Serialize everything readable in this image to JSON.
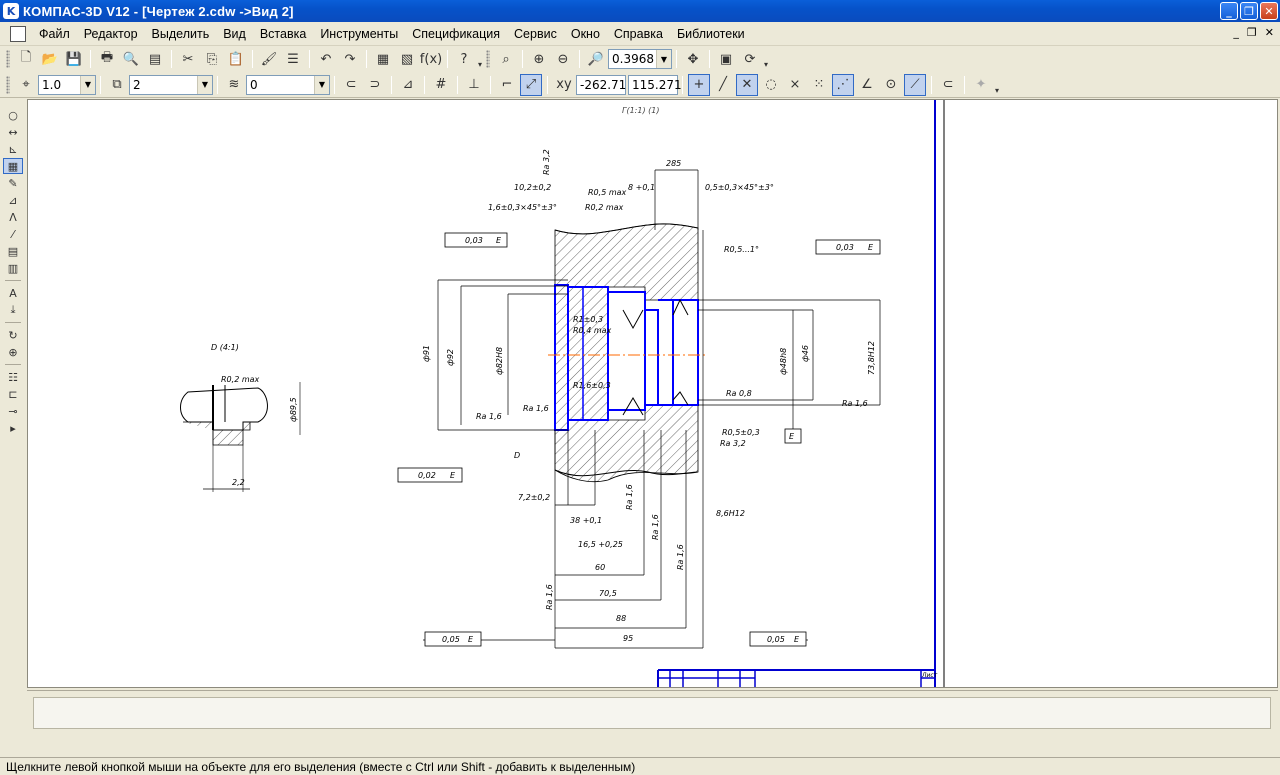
{
  "window": {
    "title": "КОМПАС-3D V12 - [Чертеж 2.cdw ->Вид 2]",
    "minimize": "_",
    "restore": "❐",
    "close": "✕"
  },
  "menu": [
    "Файл",
    "Редактор",
    "Выделить",
    "Вид",
    "Вставка",
    "Инструменты",
    "Спецификация",
    "Сервис",
    "Окно",
    "Справка",
    "Библиотеки"
  ],
  "toolbar_main": {
    "zoom_value": "0.3968"
  },
  "toolbar_params": {
    "step_value": "1.0",
    "layer_value": "2",
    "style_value": "0",
    "coord_x": "-262.71",
    "coord_y": "115.271"
  },
  "drawing": {
    "header_label": "Г(1:1) (1)",
    "detail_label": "D (4:1)",
    "dims": {
      "d285": "285",
      "d10": "10,2±0,2",
      "d16": "1,6±0,3×45°±3°",
      "r05max": "R0,5 max",
      "r02max": "R0,2 max",
      "d8": "8 +0,1",
      "d05": "0,5±0,3×45°±3°",
      "ra32": "Ra 3,2",
      "r051": "R0,5...1°",
      "tol_left": "0,03",
      "tol_right": "0,03",
      "tol_bottom_left": "0,02",
      "letter_e": "E",
      "d91": "ф91",
      "d92": "ф92",
      "d82": "ф82H8",
      "d48": "ф48h8",
      "d46": "ф46",
      "d73": "73,8H12",
      "r1": "R1±0,3",
      "r04": "R0,4 max",
      "r16": "R1,6±0,3",
      "ra16a": "Ra 1,6",
      "ra16b": "Ra 1,6",
      "ra16c": "Ra 1,6",
      "ra08": "Ra 0,8",
      "r05_03": "R0,5±0,3",
      "ra32b": "Ra 3,2",
      "letter_d": "D",
      "d72": "7,2±0,2",
      "d38": "38 +0,1",
      "d165": "16,5 +0,25",
      "d86": "8,6H12",
      "d60": "60",
      "d705": "70,5",
      "d88": "88",
      "d95": "95",
      "tol_b1": "0,05",
      "tol_b2": "0,05",
      "det_r02": "R0,2 max",
      "det_22": "2,2",
      "det_d": "ф89,5"
    },
    "title_block_sheet": "Лист"
  },
  "status": {
    "hint": "Щелкните левой кнопкой мыши на объекте для его выделения (вместе с Ctrl или Shift - добавить к выделенным)"
  },
  "colors": {
    "titlebar": "#0a5fd9",
    "part_outline": "#0000ff",
    "frame": "#0000d0",
    "axis": "#ff6a00",
    "chrome": "#ece9d8"
  }
}
